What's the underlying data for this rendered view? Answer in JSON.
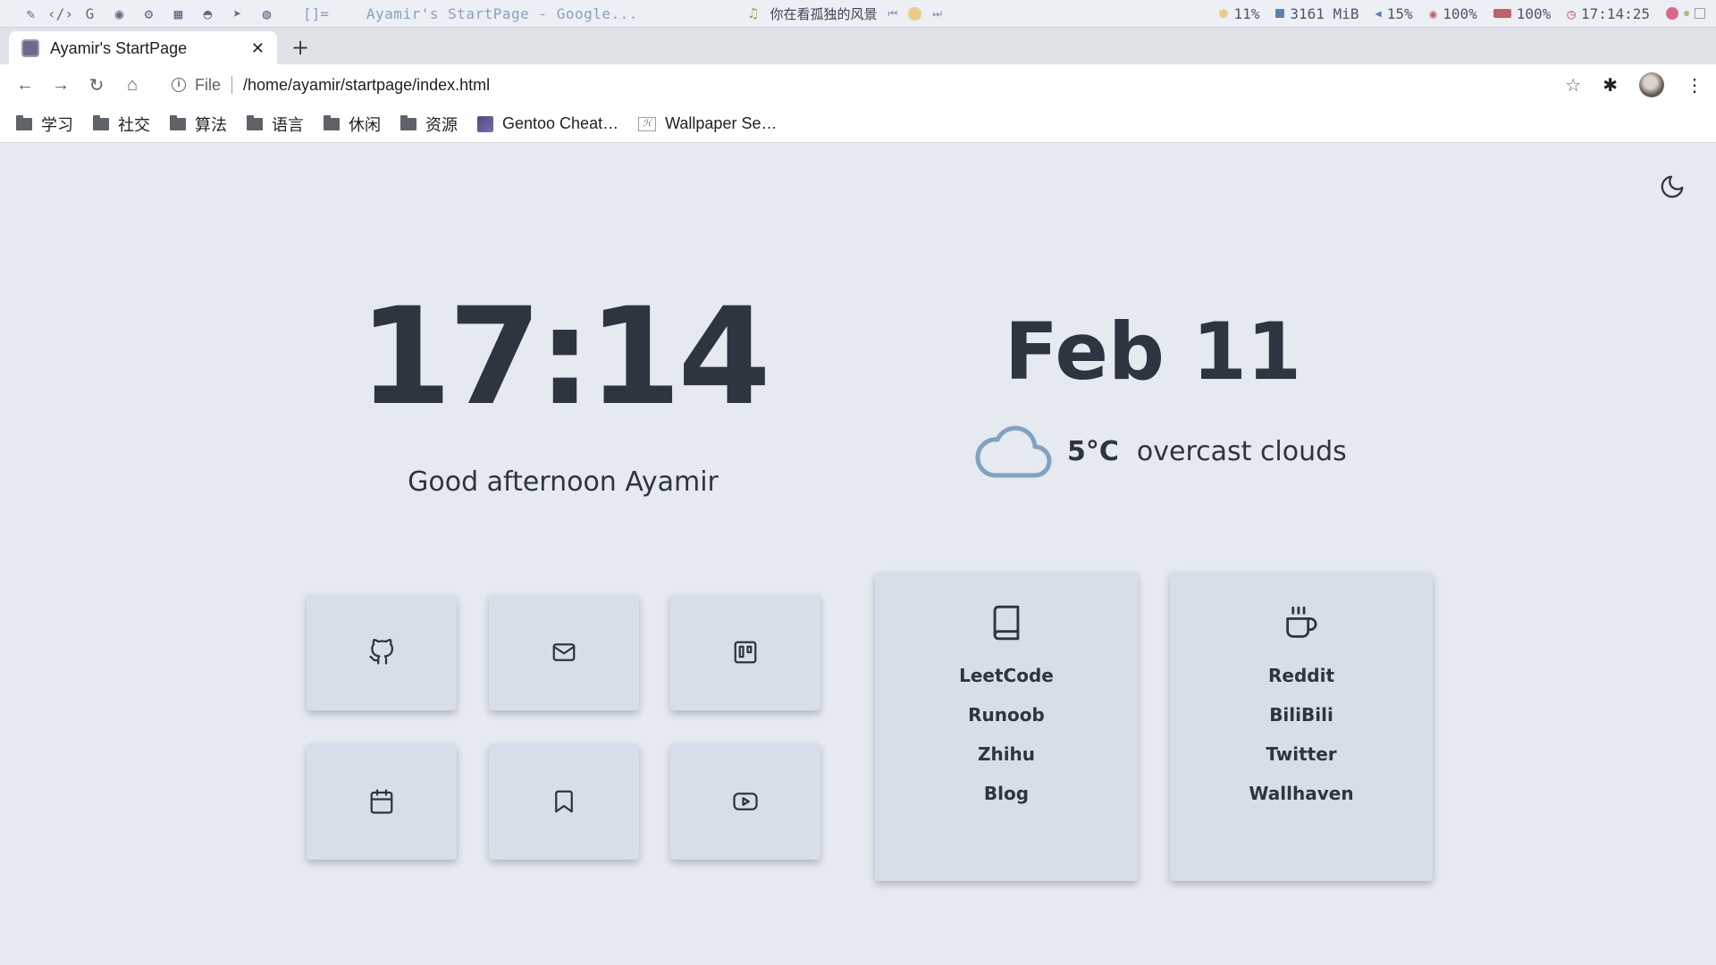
{
  "system_bar": {
    "workspace_icons": [
      "brush-icon",
      "code-icon",
      "google-icon",
      "spotify-icon",
      "steam-icon",
      "windows-icon",
      "ghost-icon",
      "telegram-icon",
      "lock-icon"
    ],
    "layout": "[]=",
    "window_title": "Ayamir's StartPage - Google...",
    "music": {
      "title": "你在看孤独的风景",
      "prev": "⏮",
      "next": "⏭"
    },
    "cpu": "11%",
    "memory": "3161 MiB",
    "volume": "15%",
    "brightness": "100%",
    "battery": "100%",
    "time": "17:14:25"
  },
  "browser": {
    "tab_title": "Ayamir's StartPage",
    "tab_close": "✕",
    "new_tab": "+",
    "url_scheme": "File",
    "url": "/home/ayamir/startpage/index.html",
    "bookmarks": [
      {
        "label": "学习",
        "icon": "folder-icon"
      },
      {
        "label": "社交",
        "icon": "folder-icon"
      },
      {
        "label": "算法",
        "icon": "folder-icon"
      },
      {
        "label": "语言",
        "icon": "folder-icon"
      },
      {
        "label": "休闲",
        "icon": "folder-icon"
      },
      {
        "label": "资源",
        "icon": "folder-icon"
      },
      {
        "label": "Gentoo Cheat…",
        "icon": "gentoo-icon"
      },
      {
        "label": "Wallpaper Se…",
        "icon": "wallpaper-icon"
      }
    ]
  },
  "startpage": {
    "clock": "17:14",
    "greeting": "Good afternoon Ayamir",
    "date": "Feb 11",
    "weather": {
      "temperature": "5°C",
      "description": "overcast clouds",
      "icon": "cloud-icon"
    },
    "quick_buttons": [
      "github-icon",
      "mail-icon",
      "trello-icon",
      "calendar-icon",
      "bookmark-icon",
      "youtube-icon"
    ],
    "cards": [
      {
        "icon": "book-icon",
        "links": [
          "LeetCode",
          "Runoob",
          "Zhihu",
          "Blog"
        ]
      },
      {
        "icon": "coffee-icon",
        "links": [
          "Reddit",
          "BiliBili",
          "Twitter",
          "Wallhaven"
        ]
      }
    ]
  },
  "colors": {
    "background": "#e5e9f0",
    "card": "#d8dee9",
    "text": "#2e3440",
    "cloud": "#81a1c1"
  }
}
